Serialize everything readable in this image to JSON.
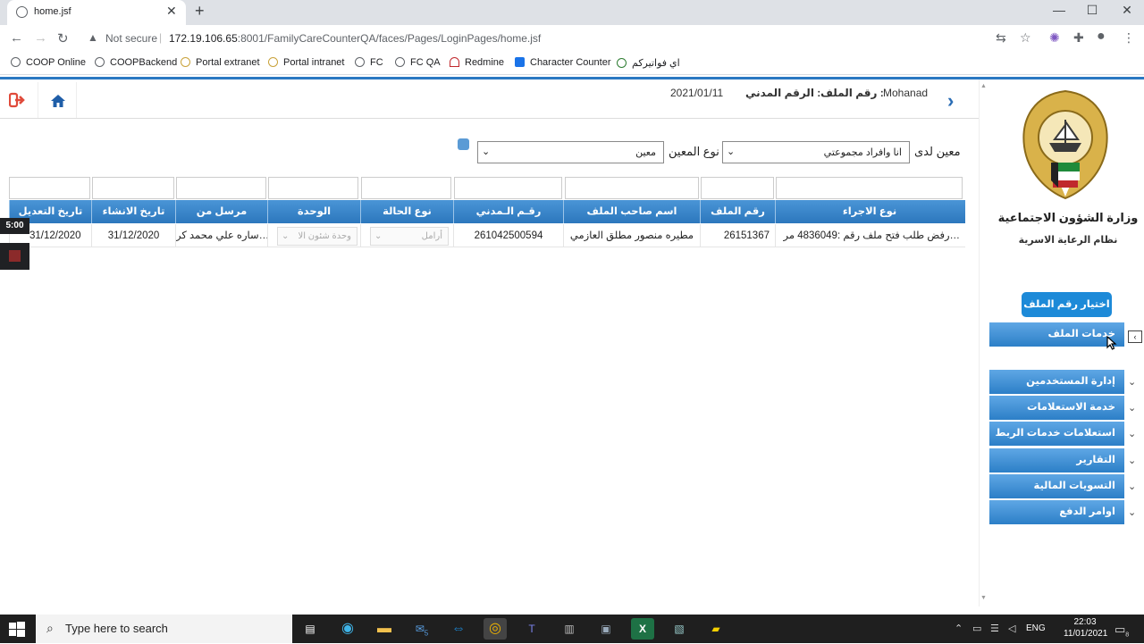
{
  "browser": {
    "tab_title": "home.jsf",
    "new_tab": "+",
    "close": "✕",
    "not_secure": "Not secure",
    "url_host": "172.19.106.65",
    "url_rest": ":8001/FamilyCareCounterQA/faces/Pages/LoginPages/home.jsf",
    "bookmarks": [
      "COOP Online",
      "COOPBackend",
      "Portal extranet",
      "Portal intranet",
      "FC",
      "FC QA",
      "Redmine",
      "Character Counter",
      "اي فواتيركم"
    ]
  },
  "header": {
    "user": "Mohanad",
    "file_number_label": "رقم الملف :",
    "civil_id_label": "الرقم المدني :",
    "date": "2021/01/11"
  },
  "filters": {
    "support_at_label": "معين لدى",
    "support_at_value": "انا وافراد مجموعتي",
    "support_type_label": "نوع المعين",
    "support_type_value": "معين"
  },
  "table": {
    "columns": [
      "نوع الاجراء",
      "رقم الملف",
      "اسم صاحب الملف",
      "رقـم الـمدني",
      "نوع الحالة",
      "الوحدة",
      "مرسل من",
      "تاريخ الانشاء",
      "تاريخ التعديل"
    ],
    "rows": [
      {
        "action": "رفض طلب فتح ملف رقم :4836049 مر…",
        "file_no": "26151367",
        "owner": "مطيره منصور مطلق العازمي",
        "civil_id": "261042500594",
        "case_type": "أرامل",
        "unit": "وحدة شئون الا",
        "sent_from": "ساره علي محمد كر…",
        "created": "31/12/2020",
        "modified": "31/12/2020"
      }
    ]
  },
  "recorder": {
    "time": "5:00"
  },
  "sidebar": {
    "ministry": "وزارة الشؤون الاجتماعية",
    "system": "نظام الرعاية الاسرية",
    "choose_file": "اختيار رقم الملف",
    "menu": [
      "خدمات الملف",
      "إدارة المستخدمين",
      "خدمة الاستعلامات",
      "استعلامات خدمات الربط",
      "التقارير",
      "التسويات المالية",
      "اوامر الدفع"
    ]
  },
  "taskbar": {
    "search_placeholder": "Type here to search",
    "lang": "ENG",
    "time": "22:03",
    "date": "11/01/2021",
    "mail_badge": "5",
    "notif_badge": "8"
  },
  "colors": {
    "accent": "#2c7fc7",
    "logout": "#e04b3b",
    "button": "#1d8ad8"
  }
}
